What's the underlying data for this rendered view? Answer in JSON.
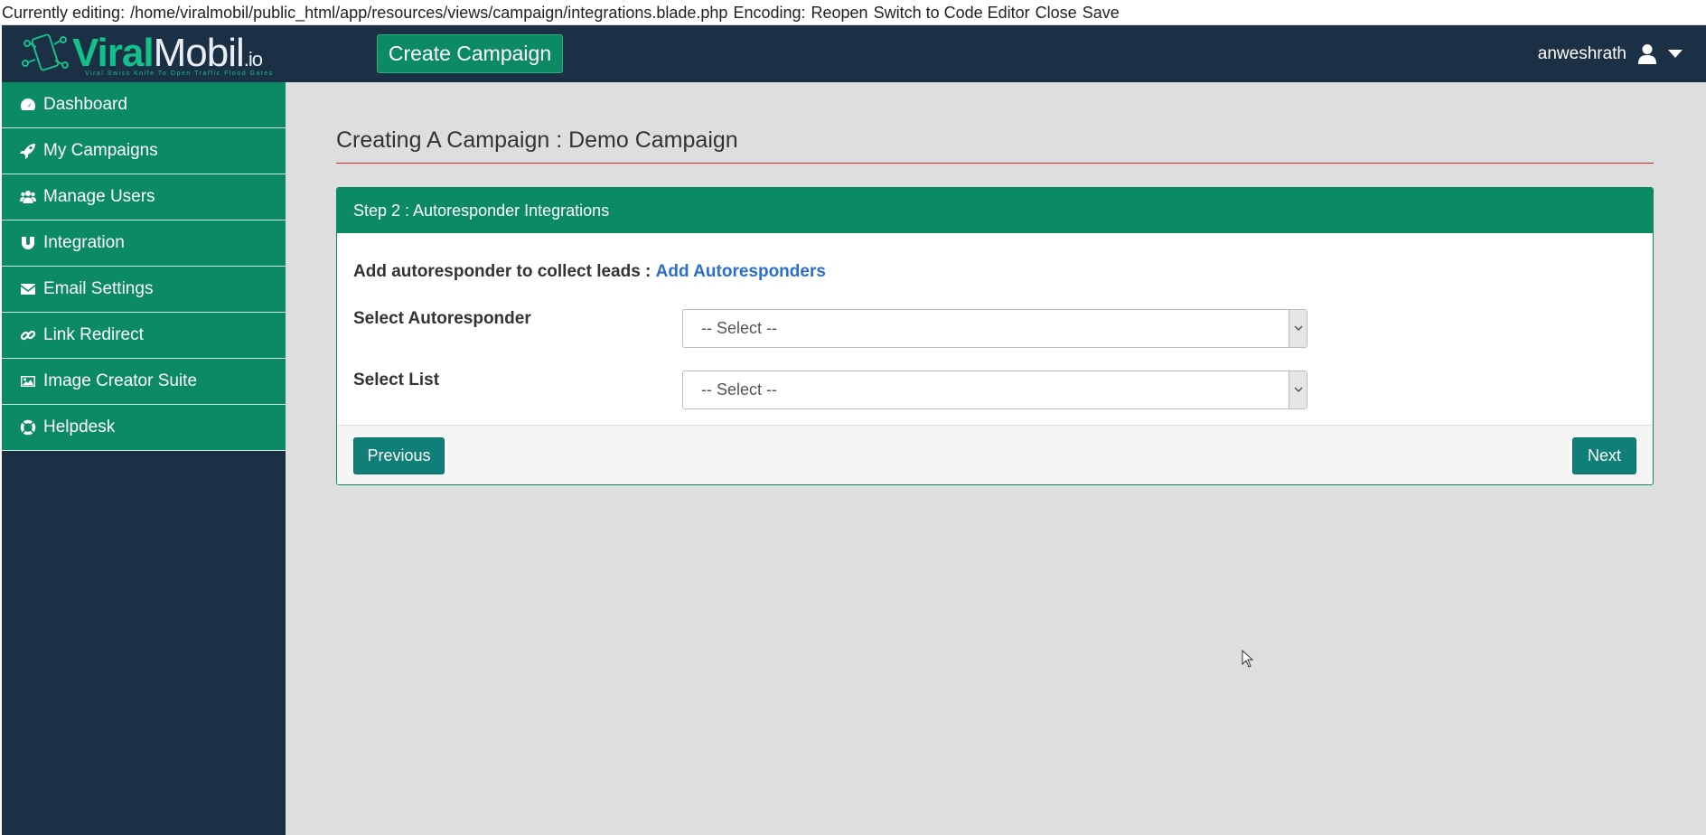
{
  "editor_bar": {
    "prefix": "Currently editing:",
    "path": "/home/viralmobil/public_html/app/resources/views/campaign/integrations.blade.php",
    "encoding": "Encoding:",
    "reopen": "Reopen",
    "switch": "Switch to Code Editor",
    "close": "Close",
    "save": "Save"
  },
  "header": {
    "logo_viral": "Viral",
    "logo_mobil": "Mobil",
    "logo_io": ".io",
    "logo_tagline": "Viral Swiss Knife To Open Traffic Flood Gates",
    "create_button": "Create Campaign",
    "username": "anweshrath",
    "user_icon": "user-icon",
    "caret_icon": "caret-down-icon"
  },
  "sidebar": {
    "items": [
      {
        "label": "Dashboard",
        "icon": "dashboard-icon"
      },
      {
        "label": "My Campaigns",
        "icon": "rocket-icon"
      },
      {
        "label": "Manage Users",
        "icon": "users-icon"
      },
      {
        "label": "Integration",
        "icon": "magnet-icon"
      },
      {
        "label": "Email Settings",
        "icon": "envelope-icon"
      },
      {
        "label": "Link Redirect",
        "icon": "link-icon"
      },
      {
        "label": "Image Creator Suite",
        "icon": "image-icon"
      },
      {
        "label": "Helpdesk",
        "icon": "lifebuoy-icon"
      }
    ]
  },
  "main": {
    "title": "Creating A Campaign : Demo Campaign",
    "panel_title": "Step 2 : Autoresponder Integrations",
    "add_label": "Add autoresponder to collect leads :",
    "add_link": "Add Autoresponders",
    "select_autoresponder_label": "Select Autoresponder",
    "select_autoresponder_value": "-- Select --",
    "select_list_label": "Select List",
    "select_list_value": "-- Select --",
    "previous_button": "Previous",
    "next_button": "Next"
  },
  "colors": {
    "header_bg": "#1b2f45",
    "accent_green": "#0b8a63",
    "button_teal": "#0f7f78",
    "link_blue": "#2a6fc9",
    "title_rule": "#c62828"
  }
}
